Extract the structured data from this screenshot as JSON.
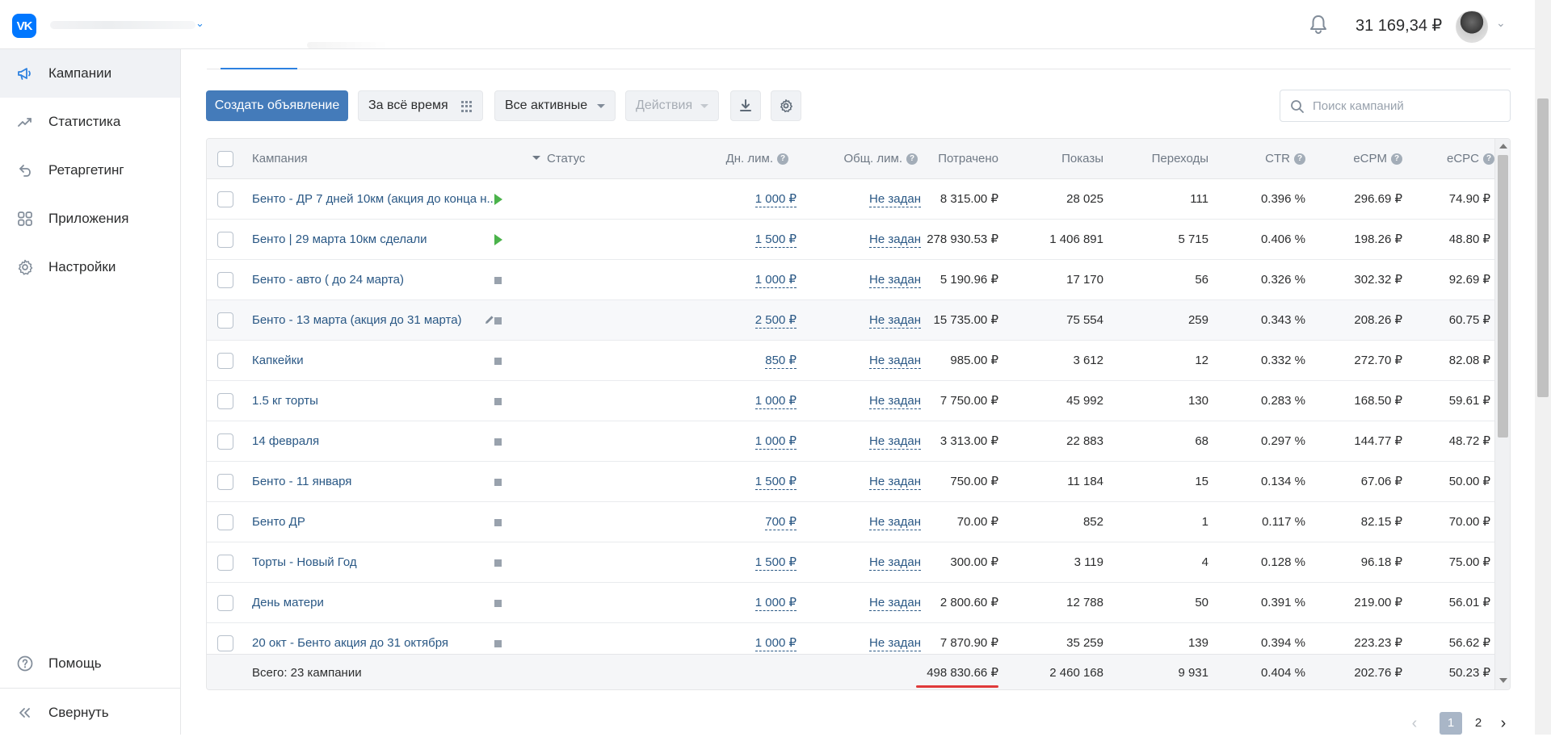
{
  "header": {
    "logo_text": "VK",
    "balance": "31 169,34 ₽",
    "account_chevron": "⌄",
    "avatar_chevron": "⌄"
  },
  "sidebar": {
    "items": [
      {
        "label": "Кампании",
        "icon": "megaphone-icon",
        "active": true
      },
      {
        "label": "Статистика",
        "icon": "chart-line-icon",
        "active": false
      },
      {
        "label": "Ретаргетинг",
        "icon": "retarget-arrow-icon",
        "active": false
      },
      {
        "label": "Приложения",
        "icon": "apps-grid-icon",
        "active": false
      },
      {
        "label": "Настройки",
        "icon": "gear-icon",
        "active": false
      }
    ],
    "help_label": "Помощь",
    "collapse_label": "Свернуть"
  },
  "toolbar": {
    "create_label": "Создать объявление",
    "period_label": "За всё время",
    "filter_label": "Все активные",
    "actions_label": "Действия",
    "search_placeholder": "Поиск кампаний"
  },
  "table": {
    "headers": {
      "campaign": "Кампания",
      "status": "Статус",
      "day_limit": "Дн. лим.",
      "total_limit": "Общ. лим.",
      "spent": "Потрачено",
      "impressions": "Показы",
      "clicks": "Переходы",
      "ctr": "CTR",
      "ecpm": "eCPM",
      "ecpc": "eCPC"
    },
    "rows": [
      {
        "name": "Бенто - ДР 7 дней 10км (акция до конца н...",
        "status": "active",
        "day_limit": "1 000 ₽",
        "total_limit": "Не задан",
        "spent": "8 315.00 ₽",
        "impressions": "28 025",
        "clicks": "111",
        "ctr": "0.396 %",
        "ecpm": "296.69 ₽",
        "ecpc": "74.90 ₽"
      },
      {
        "name": "Бенто | 29 марта 10км сделали",
        "status": "active",
        "day_limit": "1 500 ₽",
        "total_limit": "Не задан",
        "spent": "278 930.53 ₽",
        "impressions": "1 406 891",
        "clicks": "5 715",
        "ctr": "0.406 %",
        "ecpm": "198.26 ₽",
        "ecpc": "48.80 ₽"
      },
      {
        "name": "Бенто - авто ( до 24 марта)",
        "status": "stopped",
        "day_limit": "1 000 ₽",
        "total_limit": "Не задан",
        "spent": "5 190.96 ₽",
        "impressions": "17 170",
        "clicks": "56",
        "ctr": "0.326 %",
        "ecpm": "302.32 ₽",
        "ecpc": "92.69 ₽"
      },
      {
        "name": "Бенто - 13 марта (акция до 31 марта)",
        "status": "stopped",
        "day_limit": "2 500 ₽",
        "total_limit": "Не задан",
        "spent": "15 735.00 ₽",
        "impressions": "75 554",
        "clicks": "259",
        "ctr": "0.343 %",
        "ecpm": "208.26 ₽",
        "ecpc": "60.75 ₽",
        "hover": true
      },
      {
        "name": "Капкейки",
        "status": "stopped",
        "day_limit": "850 ₽",
        "total_limit": "Не задан",
        "spent": "985.00 ₽",
        "impressions": "3 612",
        "clicks": "12",
        "ctr": "0.332 %",
        "ecpm": "272.70 ₽",
        "ecpc": "82.08 ₽"
      },
      {
        "name": "1.5 кг торты",
        "status": "stopped",
        "day_limit": "1 000 ₽",
        "total_limit": "Не задан",
        "spent": "7 750.00 ₽",
        "impressions": "45 992",
        "clicks": "130",
        "ctr": "0.283 %",
        "ecpm": "168.50 ₽",
        "ecpc": "59.61 ₽"
      },
      {
        "name": "14 февраля",
        "status": "stopped",
        "day_limit": "1 000 ₽",
        "total_limit": "Не задан",
        "spent": "3 313.00 ₽",
        "impressions": "22 883",
        "clicks": "68",
        "ctr": "0.297 %",
        "ecpm": "144.77 ₽",
        "ecpc": "48.72 ₽"
      },
      {
        "name": "Бенто - 11 января",
        "status": "stopped",
        "day_limit": "1 500 ₽",
        "total_limit": "Не задан",
        "spent": "750.00 ₽",
        "impressions": "11 184",
        "clicks": "15",
        "ctr": "0.134 %",
        "ecpm": "67.06 ₽",
        "ecpc": "50.00 ₽"
      },
      {
        "name": "Бенто ДР",
        "status": "stopped",
        "day_limit": "700 ₽",
        "total_limit": "Не задан",
        "spent": "70.00 ₽",
        "impressions": "852",
        "clicks": "1",
        "ctr": "0.117 %",
        "ecpm": "82.15 ₽",
        "ecpc": "70.00 ₽"
      },
      {
        "name": "Торты - Новый Год",
        "status": "stopped",
        "day_limit": "1 500 ₽",
        "total_limit": "Не задан",
        "spent": "300.00 ₽",
        "impressions": "3 119",
        "clicks": "4",
        "ctr": "0.128 %",
        "ecpm": "96.18 ₽",
        "ecpc": "75.00 ₽"
      },
      {
        "name": "День матери",
        "status": "stopped",
        "day_limit": "1 000 ₽",
        "total_limit": "Не задан",
        "spent": "2 800.60 ₽",
        "impressions": "12 788",
        "clicks": "50",
        "ctr": "0.391 %",
        "ecpm": "219.00 ₽",
        "ecpc": "56.01 ₽"
      },
      {
        "name": "20 окт - Бенто акция до 31 октября",
        "status": "stopped",
        "day_limit": "1 000 ₽",
        "total_limit": "Не задан",
        "spent": "7 870.90 ₽",
        "impressions": "35 259",
        "clicks": "139",
        "ctr": "0.394 %",
        "ecpm": "223.23 ₽",
        "ecpc": "56.62 ₽"
      }
    ],
    "totals": {
      "label": "Всего: 23 кампании",
      "spent": "498 830.66 ₽",
      "impressions": "2 460 168",
      "clicks": "9 931",
      "ctr": "0.404 %",
      "ecpm": "202.76 ₽",
      "ecpc": "50.23 ₽"
    }
  },
  "pagination": {
    "prev": "‹",
    "pages": [
      "1",
      "2"
    ],
    "current": "1",
    "next": "›"
  },
  "colors": {
    "accent": "#447bba",
    "link": "#2a5885",
    "active_status": "#4bb34b",
    "stopped_status": "#99a2ad",
    "highlight_underline": "#e03a3a"
  }
}
